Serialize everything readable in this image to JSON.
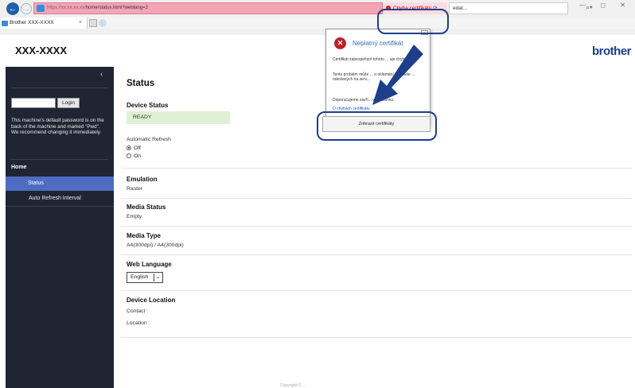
{
  "browser": {
    "url_host": "https://xx.xx.xx.xx/",
    "url_path": "home/status.html?weblang=2",
    "cert_error": "Chyba certifikátu",
    "search_text": "edat...",
    "tab_title": "Brother XXX-XXXX",
    "tab_close": "×",
    "window_controls": "— ◻ ✕"
  },
  "header": {
    "model": "XXX-XXXX",
    "brand": "brother"
  },
  "sidebar": {
    "collapse": "‹",
    "login_label": "Login",
    "password_note": "This machine's default password is on the back of the machine and marked \"Pwd\". We recommend changing it immediately.",
    "home_label": "Home",
    "items": [
      {
        "label": "Status"
      },
      {
        "label": "Auto Refresh Interval"
      }
    ]
  },
  "main": {
    "title": "Status",
    "device_status": {
      "title": "Device Status",
      "value": "READY"
    },
    "auto_refresh": {
      "title": "Automatic Refresh",
      "off": "Off",
      "on": "On",
      "selected": "Off"
    },
    "emulation": {
      "title": "Emulation",
      "value": "Raster"
    },
    "media_status": {
      "title": "Media Status",
      "value": "Empty"
    },
    "media_type": {
      "title": "Media Type",
      "value": "A4(300dpi) / A4(300dpi)"
    },
    "web_language": {
      "title": "Web Language",
      "value": "English"
    },
    "device_location": {
      "title": "Device Location",
      "contact": "Contact :",
      "location": "Location :"
    },
    "footer": "Copyright © ..."
  },
  "cert_popup": {
    "title": "Neplatný certifikát",
    "text1": "Certifikát zabezpečení tohoto ... uje chyby.",
    "text2": "Tento problém může ... o oklamání uživatele ... odeslaných na serv...",
    "text3": "Doporučujeme zavří... vou stránku.",
    "link": "O chybách certifikátu",
    "button": "Zobrazit certifikáty"
  },
  "colors": {
    "sidebar_bg": "#1f2533",
    "sidebar_active": "#4e6cc2",
    "ready_bg": "#dff1d4",
    "callout": "#1d3e8a",
    "address_error": "#f3a5b5"
  }
}
